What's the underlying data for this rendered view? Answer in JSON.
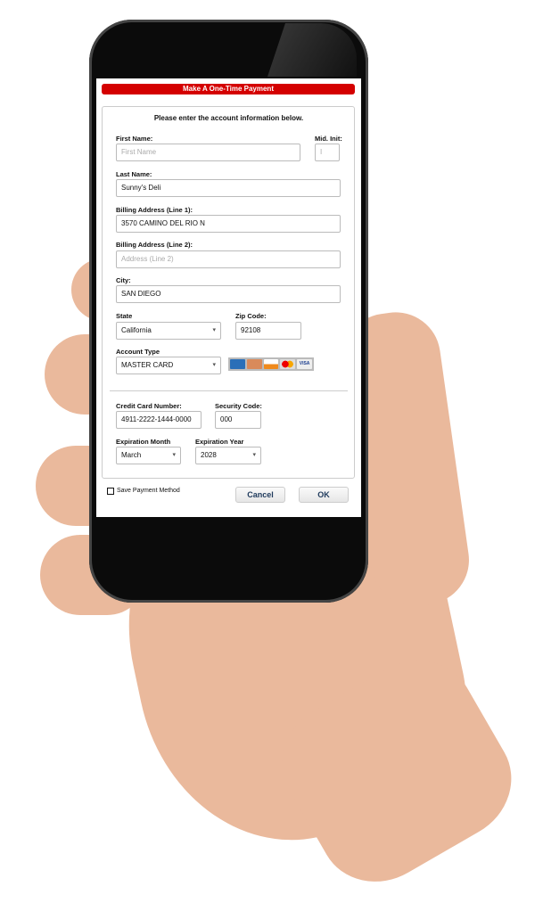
{
  "header": {
    "title": "Make A One-Time Payment"
  },
  "form": {
    "instruction": "Please enter the account information below.",
    "first_name": {
      "label": "First Name:",
      "value": "",
      "placeholder": "First Name"
    },
    "mid_init": {
      "label": "Mid. Init:",
      "value": "",
      "placeholder": "I"
    },
    "last_name": {
      "label": "Last Name:",
      "value": "Sunny's Deli"
    },
    "address1": {
      "label": "Billing Address (Line 1):",
      "value": "3570 CAMINO DEL RIO N"
    },
    "address2": {
      "label": "Billing Address (Line 2):",
      "value": "",
      "placeholder": "Address (Line 2)"
    },
    "city": {
      "label": "City:",
      "value": "SAN DIEGO"
    },
    "state": {
      "label": "State",
      "value": "California"
    },
    "zip": {
      "label": "Zip Code:",
      "value": "92108"
    },
    "account_type": {
      "label": "Account Type",
      "value": "MASTER CARD"
    },
    "card_logos": [
      "AMEX",
      "ECHECK",
      "DISCOVER",
      "MASTERCARD",
      "VISA"
    ],
    "cc_number": {
      "label": "Credit Card Number:",
      "value": "4911-2222-1444-0000"
    },
    "security_code": {
      "label": "Security Code:",
      "value": "000"
    },
    "exp_month": {
      "label": "Expiration Month",
      "value": "March"
    },
    "exp_year": {
      "label": "Expiration Year",
      "value": "2028"
    }
  },
  "footer": {
    "save_label": "Save Payment Method",
    "save_checked": false,
    "cancel": "Cancel",
    "ok": "OK"
  },
  "colors": {
    "header": "#d40000",
    "button_text": "#1f3a5c"
  }
}
